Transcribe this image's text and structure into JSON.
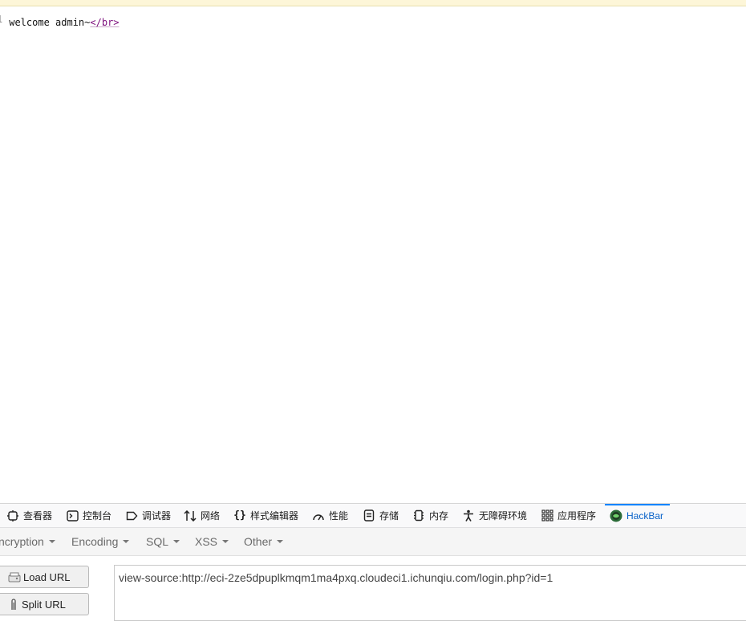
{
  "page": {
    "source_line_number": "1",
    "source_text": "welcome admin~",
    "source_tag": "</br>"
  },
  "devtools": {
    "tabs": [
      {
        "label": "查看器",
        "icon": "inspector-icon"
      },
      {
        "label": "控制台",
        "icon": "console-icon"
      },
      {
        "label": "调试器",
        "icon": "debugger-icon"
      },
      {
        "label": "网络",
        "icon": "network-icon"
      },
      {
        "label": "样式编辑器",
        "icon": "style-editor-icon"
      },
      {
        "label": "性能",
        "icon": "performance-icon"
      },
      {
        "label": "存储",
        "icon": "storage-icon"
      },
      {
        "label": "内存",
        "icon": "memory-icon"
      },
      {
        "label": "无障碍环境",
        "icon": "accessibility-icon"
      },
      {
        "label": "应用程序",
        "icon": "application-icon"
      },
      {
        "label": "HackBar",
        "icon": "hackbar-icon",
        "active": true
      }
    ]
  },
  "hackbar": {
    "menu": [
      "ncryption",
      "Encoding",
      "SQL",
      "XSS",
      "Other"
    ],
    "load_url_label": "Load URL",
    "split_url_label": "Split URL",
    "url_value": "view-source:http://eci-2ze5dpuplkmqm1ma4pxq.cloudeci1.ichunqiu.com/login.php?id=1"
  },
  "colors": {
    "active_tab": "#0a84ff",
    "source_tag": "#7c0d7c"
  }
}
